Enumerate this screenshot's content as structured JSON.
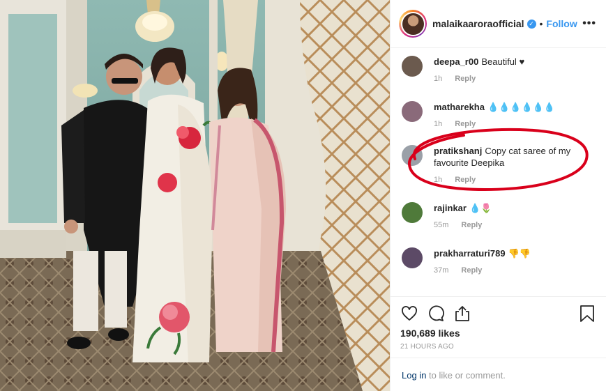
{
  "post": {
    "username": "malaikaaroraofficial",
    "follow_label": "Follow",
    "dot": "•",
    "more_label": "•••",
    "verified_mark": "✓"
  },
  "comments": [
    {
      "user": "deepa_r00",
      "text": "Beautiful ♥",
      "time": "1h",
      "reply": "Reply",
      "avatar_color": "#6b5a4e"
    },
    {
      "user": "matharekha",
      "text": "💧💧💧💧💧💧",
      "time": "1h",
      "reply": "Reply",
      "avatar_color": "#8a6a7a"
    },
    {
      "user": "pratikshanj",
      "text": "Copy cat saree of my favourite Deepika",
      "time": "1h",
      "reply": "Reply",
      "avatar_color": "#9aa0a8"
    },
    {
      "user": "rajinkar",
      "text": "💧🌷",
      "time": "55m",
      "reply": "Reply",
      "avatar_color": "#4f7a3a"
    },
    {
      "user": "prakharraturi789",
      "text": "👎👎",
      "time": "37m",
      "reply": "Reply",
      "avatar_color": "#5c4a66"
    }
  ],
  "actions": {
    "icons": [
      "heart-icon",
      "comment-icon",
      "share-icon",
      "bookmark-icon"
    ],
    "likes": "190,689 likes",
    "time_ago": "21 HOURS AGO"
  },
  "login": {
    "link": "Log in",
    "rest": " to like or comment."
  },
  "colors": {
    "accent": "#3897f0",
    "annotation": "#d9001b",
    "wall": "#7ea9a3"
  }
}
